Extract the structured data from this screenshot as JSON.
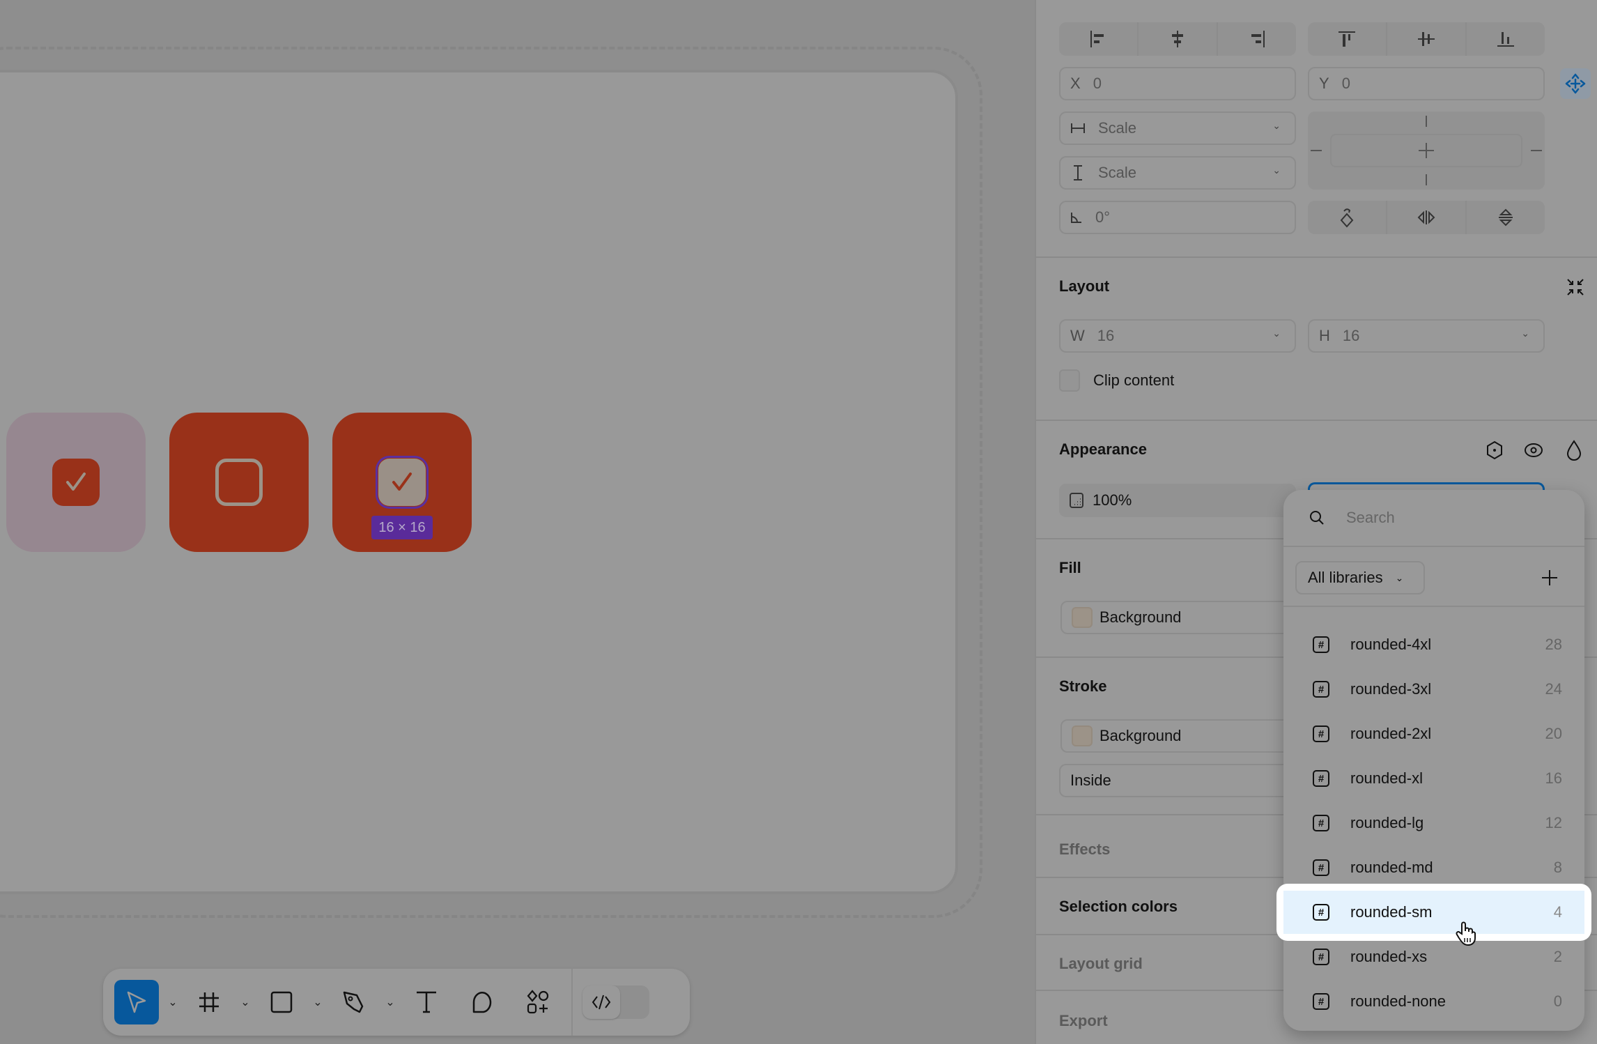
{
  "canvas": {
    "size_badge": "16 × 16",
    "colors": {
      "accent": "#993119",
      "tile_muted": "#968790",
      "selection": "#5a2b9a"
    }
  },
  "toolbar": {
    "tools": [
      {
        "name": "move-tool",
        "icon": "cursor-arrow-icon",
        "active": true,
        "has_menu": true
      },
      {
        "name": "frame-tool",
        "icon": "frame-hash-icon",
        "has_menu": true
      },
      {
        "name": "rectangle-tool",
        "icon": "rectangle-icon",
        "has_menu": true
      },
      {
        "name": "pen-tool",
        "icon": "pen-nib-icon",
        "has_menu": true
      },
      {
        "name": "text-tool",
        "icon": "text-t-icon"
      },
      {
        "name": "comment-tool",
        "icon": "comment-bubble-icon"
      },
      {
        "name": "assets-tool",
        "icon": "shapes-plus-icon"
      }
    ],
    "dev_mode_icon": "code-brackets-icon",
    "accent": "#07589c"
  },
  "panel": {
    "position": {
      "x_label": "X",
      "x_value": "0",
      "y_label": "Y",
      "y_value": "0",
      "h_constraint": "Scale",
      "v_constraint": "Scale",
      "rotation": "0°"
    },
    "layout": {
      "title": "Layout",
      "w_label": "W",
      "w_value": "16",
      "h_label": "H",
      "h_value": "16",
      "clip_content_label": "Clip content",
      "clip_content_checked": false
    },
    "appearance": {
      "title": "Appearance",
      "opacity": "100%"
    },
    "fill": {
      "title": "Fill",
      "value": "Background"
    },
    "stroke": {
      "title": "Stroke",
      "value": "Background",
      "position": "Inside"
    },
    "effects": {
      "title": "Effects"
    },
    "selection_colors": {
      "title": "Selection colors"
    },
    "layout_grid": {
      "title": "Layout grid"
    },
    "export": {
      "title": "Export"
    }
  },
  "dropdown": {
    "search_placeholder": "Search",
    "library_filter": "All libraries",
    "items": [
      {
        "name": "rounded-4xl",
        "value": "28"
      },
      {
        "name": "rounded-3xl",
        "value": "24"
      },
      {
        "name": "rounded-2xl",
        "value": "20"
      },
      {
        "name": "rounded-xl",
        "value": "16"
      },
      {
        "name": "rounded-lg",
        "value": "12"
      },
      {
        "name": "rounded-md",
        "value": "8"
      },
      {
        "name": "rounded-sm",
        "value": "4",
        "hovered": true
      },
      {
        "name": "rounded-xs",
        "value": "2"
      },
      {
        "name": "rounded-none",
        "value": "0"
      }
    ]
  }
}
